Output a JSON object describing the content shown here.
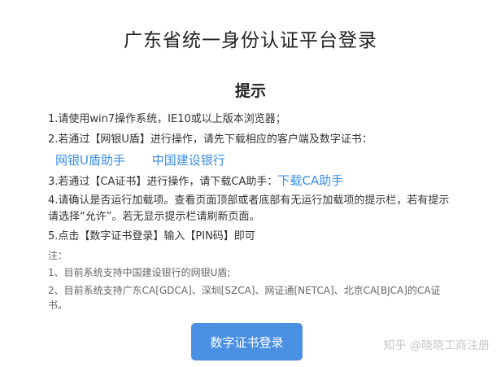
{
  "page": {
    "title": "广东省统一身份认证平台登录",
    "heading": "提示"
  },
  "steps": {
    "step1": "1.请使用win7操作系统，IE10或以上版本浏览器；",
    "step2": "2.若通过【网银U盾】进行操作，请先下载相应的客户端及数字证书：",
    "step2_links": [
      "网银U盾助手",
      "中国建设银行"
    ],
    "step3_text": "3.若通过【CA证书】进行操作，请下载CA助手：",
    "step3_link": "下载CA助手",
    "step4": "4.请确认是否运行加载项。查看页面顶部或者底部有无运行加载项的提示栏，若有提示请选择“允许”。若无显示提示栏请刷新页面。",
    "step5": "5.点击【数字证书登录】输入【PIN码】即可"
  },
  "notes": {
    "label": "注：",
    "note1": "1、目前系统支持中国建设银行的网银U盾;",
    "note2": "2、目前系统支持广东CA[GDCA]、深圳[SZCA]、网证通[NETCA]、北京CA[BJCA]的CA证书。"
  },
  "actions": {
    "login_button": "数字证书登录"
  },
  "watermark": "知乎 @晓晓工商注册",
  "colors": {
    "link": "#3a8ee6",
    "button": "#4a90e2"
  }
}
